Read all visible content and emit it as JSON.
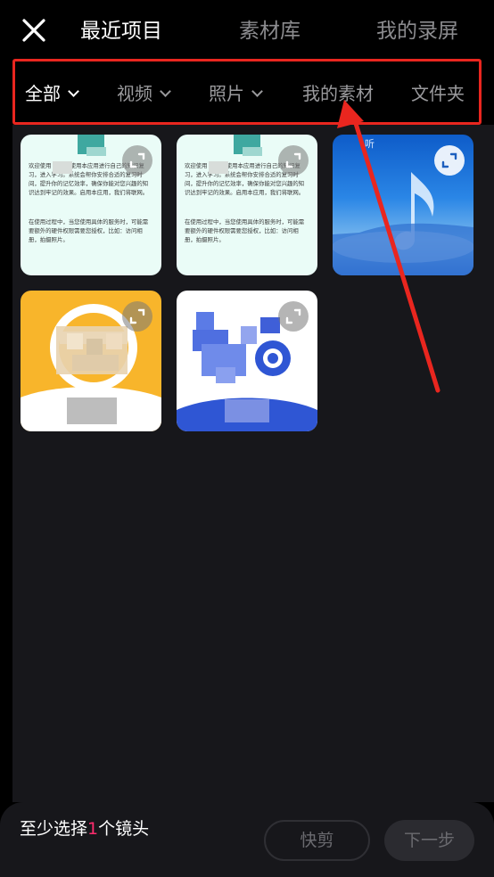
{
  "header": {
    "close_icon": "close-icon",
    "tabs": [
      {
        "label": "最近项目",
        "active": true
      },
      {
        "label": "素材库",
        "active": false
      },
      {
        "label": "我的录屏",
        "active": false
      }
    ]
  },
  "filters": [
    {
      "label": "全部",
      "dropdown": true,
      "active": true
    },
    {
      "label": "视频",
      "dropdown": true,
      "active": false
    },
    {
      "label": "照片",
      "dropdown": true,
      "active": false
    },
    {
      "label": "我的素材",
      "dropdown": false,
      "active": false
    },
    {
      "label": "文件夹",
      "dropdown": false,
      "active": false
    }
  ],
  "annotation": {
    "color": "#e9261f"
  },
  "media": {
    "doc_text_1": "欢迎使用 您可以使用本应用进行自己的知识复习，进入学习。系统会帮你安排合适的复习时间，提升你的记忆效率，确保你能对您兴趣的知识达到牢记的效果。启用本应用，我们将联网。",
    "doc_text_2": "在使用过程中，当您使用具体的服务时，可能需要额外的硬件权限需要您授权，比如：访问相册，拍摄照片。",
    "music_label": "听"
  },
  "bottom": {
    "hint_prefix": "至少选择",
    "hint_count": "1",
    "hint_suffix": "个镜头",
    "quick_cut": "快剪",
    "next": "下一步"
  },
  "colors": {
    "accent": "#ff2c6e",
    "background": "#000000",
    "panel": "#17171b"
  }
}
